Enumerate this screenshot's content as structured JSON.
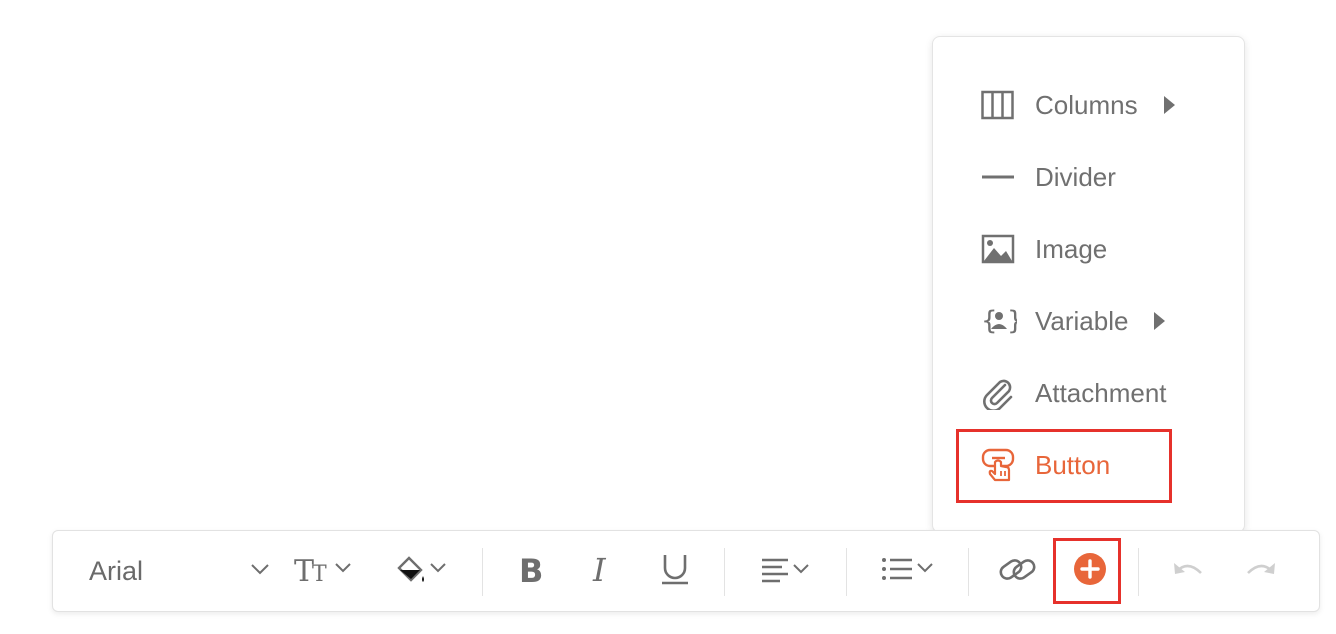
{
  "menu": {
    "items": [
      {
        "label": "Columns",
        "icon": "columns-icon",
        "submenu": true
      },
      {
        "label": "Divider",
        "icon": "divider-icon",
        "submenu": false
      },
      {
        "label": "Image",
        "icon": "image-icon",
        "submenu": false
      },
      {
        "label": "Variable",
        "icon": "variable-icon",
        "submenu": true
      },
      {
        "label": "Attachment",
        "icon": "paperclip-icon",
        "submenu": false
      },
      {
        "label": "Button",
        "icon": "button-hand-icon",
        "submenu": false,
        "highlighted": true
      }
    ],
    "accent_color": "#e8663a",
    "highlight_color": "#e6312b"
  },
  "toolbar": {
    "font": {
      "value": "Arial"
    },
    "tools": [
      "font-size-icon",
      "fill-color-icon",
      "bold-icon",
      "italic-icon",
      "underline-icon",
      "align-icon",
      "list-icon",
      "link-icon",
      "insert-plus-icon",
      "undo-icon",
      "redo-icon"
    ],
    "plus_color": "#e8663a"
  }
}
